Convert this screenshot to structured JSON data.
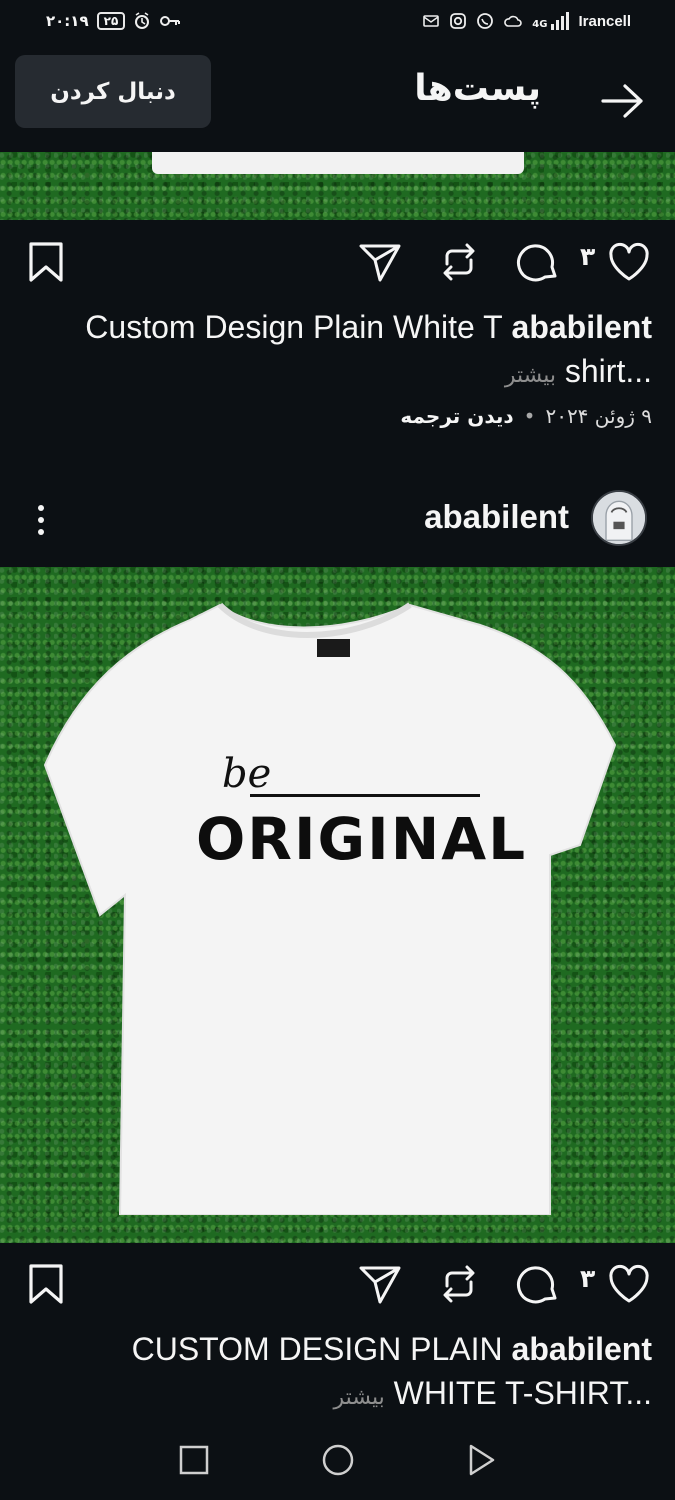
{
  "status_bar": {
    "time": "۲۰:۱۹",
    "battery": "۲۵",
    "network_type": "4G",
    "carrier": "Irancell",
    "icons_right": [
      "mail-icon",
      "instagram-icon",
      "whatsapp-icon",
      "cloud-icon",
      "signal-icon"
    ],
    "icons_left": [
      "battery-icon",
      "alarm-icon",
      "key-icon"
    ]
  },
  "header": {
    "title": "پست‌ها",
    "follow_label": "دنبال کردن"
  },
  "post1": {
    "like_count": "۳",
    "username": "ababilent",
    "caption_text": "Custom Design Plain White T shirt...",
    "more_label": "بیشتر",
    "date": "۹ ژوئن ۲۰۲۴",
    "translate_label": "دیدن ترجمه"
  },
  "post2": {
    "username": "ababilent",
    "print_script": "be",
    "print_main": "ORIGINAL",
    "like_count": "۳",
    "caption_text": "CUSTOM DESIGN PLAIN WHITE T-SHIRT...",
    "more_label": "بیشتر"
  },
  "colors": {
    "background": "#0c1014",
    "button_bg": "#262b31",
    "grass": "#1f6a21",
    "muted_text": "#8e8e8e"
  }
}
